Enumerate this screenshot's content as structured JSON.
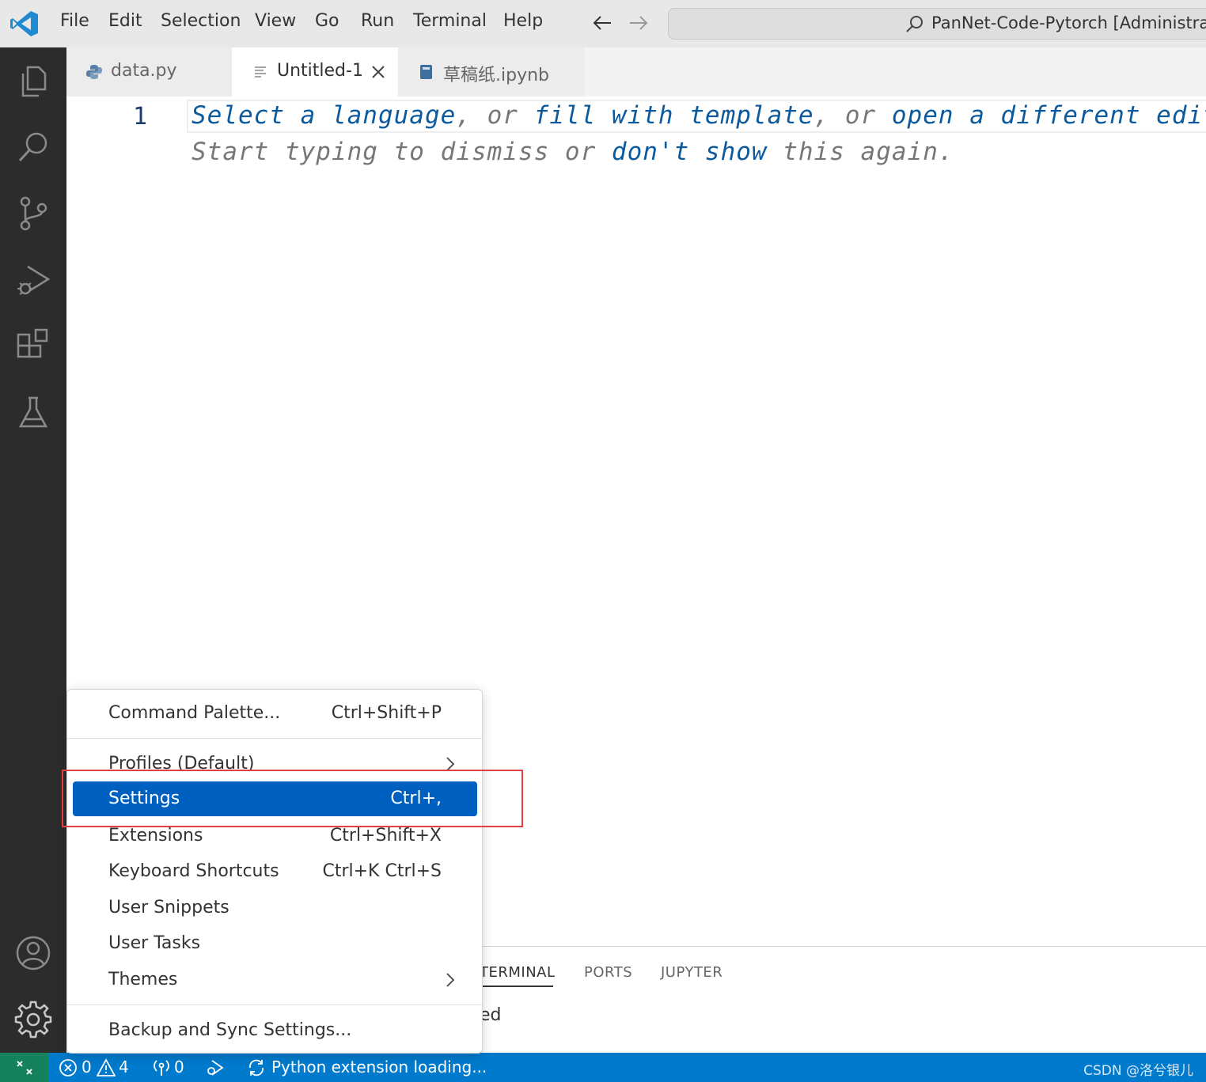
{
  "titlebar": {
    "menus": [
      "File",
      "Edit",
      "Selection",
      "View",
      "Go",
      "Run",
      "Terminal",
      "Help"
    ],
    "title": "PanNet-Code-Pytorch [Administrator]",
    "accent": "#007acc"
  },
  "tabs": [
    {
      "label": "data.py",
      "icon": "python-icon",
      "active": false
    },
    {
      "label": "Untitled-1",
      "icon": "text-file-icon",
      "active": true
    },
    {
      "label": "草稿纸.ipynb",
      "icon": "notebook-icon",
      "active": false
    }
  ],
  "editor": {
    "line_number": "1",
    "hint_line1": {
      "p1": "Select a language",
      "p2": ", or ",
      "p3": "fill with template",
      "p4": ", or ",
      "p5": "open a different edito"
    },
    "hint_line2": {
      "p1": "Start typing to dismiss or ",
      "p2": "don't show",
      "p3": " this again."
    }
  },
  "panel": {
    "tabs": [
      "TERMINAL",
      "PORTS",
      "JUPYTER"
    ],
    "content": "ed"
  },
  "context_menu": {
    "items": [
      {
        "label": "Command Palette...",
        "shortcut": "Ctrl+Shift+P"
      },
      {
        "label": "Profiles (Default)",
        "submenu": true
      },
      {
        "label": "Settings",
        "shortcut": "Ctrl+,",
        "selected": true
      },
      {
        "label": "Extensions",
        "shortcut": "Ctrl+Shift+X"
      },
      {
        "label": "Keyboard Shortcuts",
        "shortcut": "Ctrl+K Ctrl+S"
      },
      {
        "label": "User Snippets"
      },
      {
        "label": "User Tasks"
      },
      {
        "label": "Themes",
        "submenu": true
      },
      {
        "label": "Backup and Sync Settings..."
      }
    ]
  },
  "statusbar": {
    "errors": "0",
    "warnings": "4",
    "ports": "0",
    "message": "Python extension loading...",
    "watermark": "CSDN @洛兮银儿"
  },
  "colors": {
    "statusbar": "#007acc",
    "remote": "#16825d",
    "selection": "#0060c0",
    "activitybar": "#2c2c2c",
    "highlight": "#e04040"
  }
}
